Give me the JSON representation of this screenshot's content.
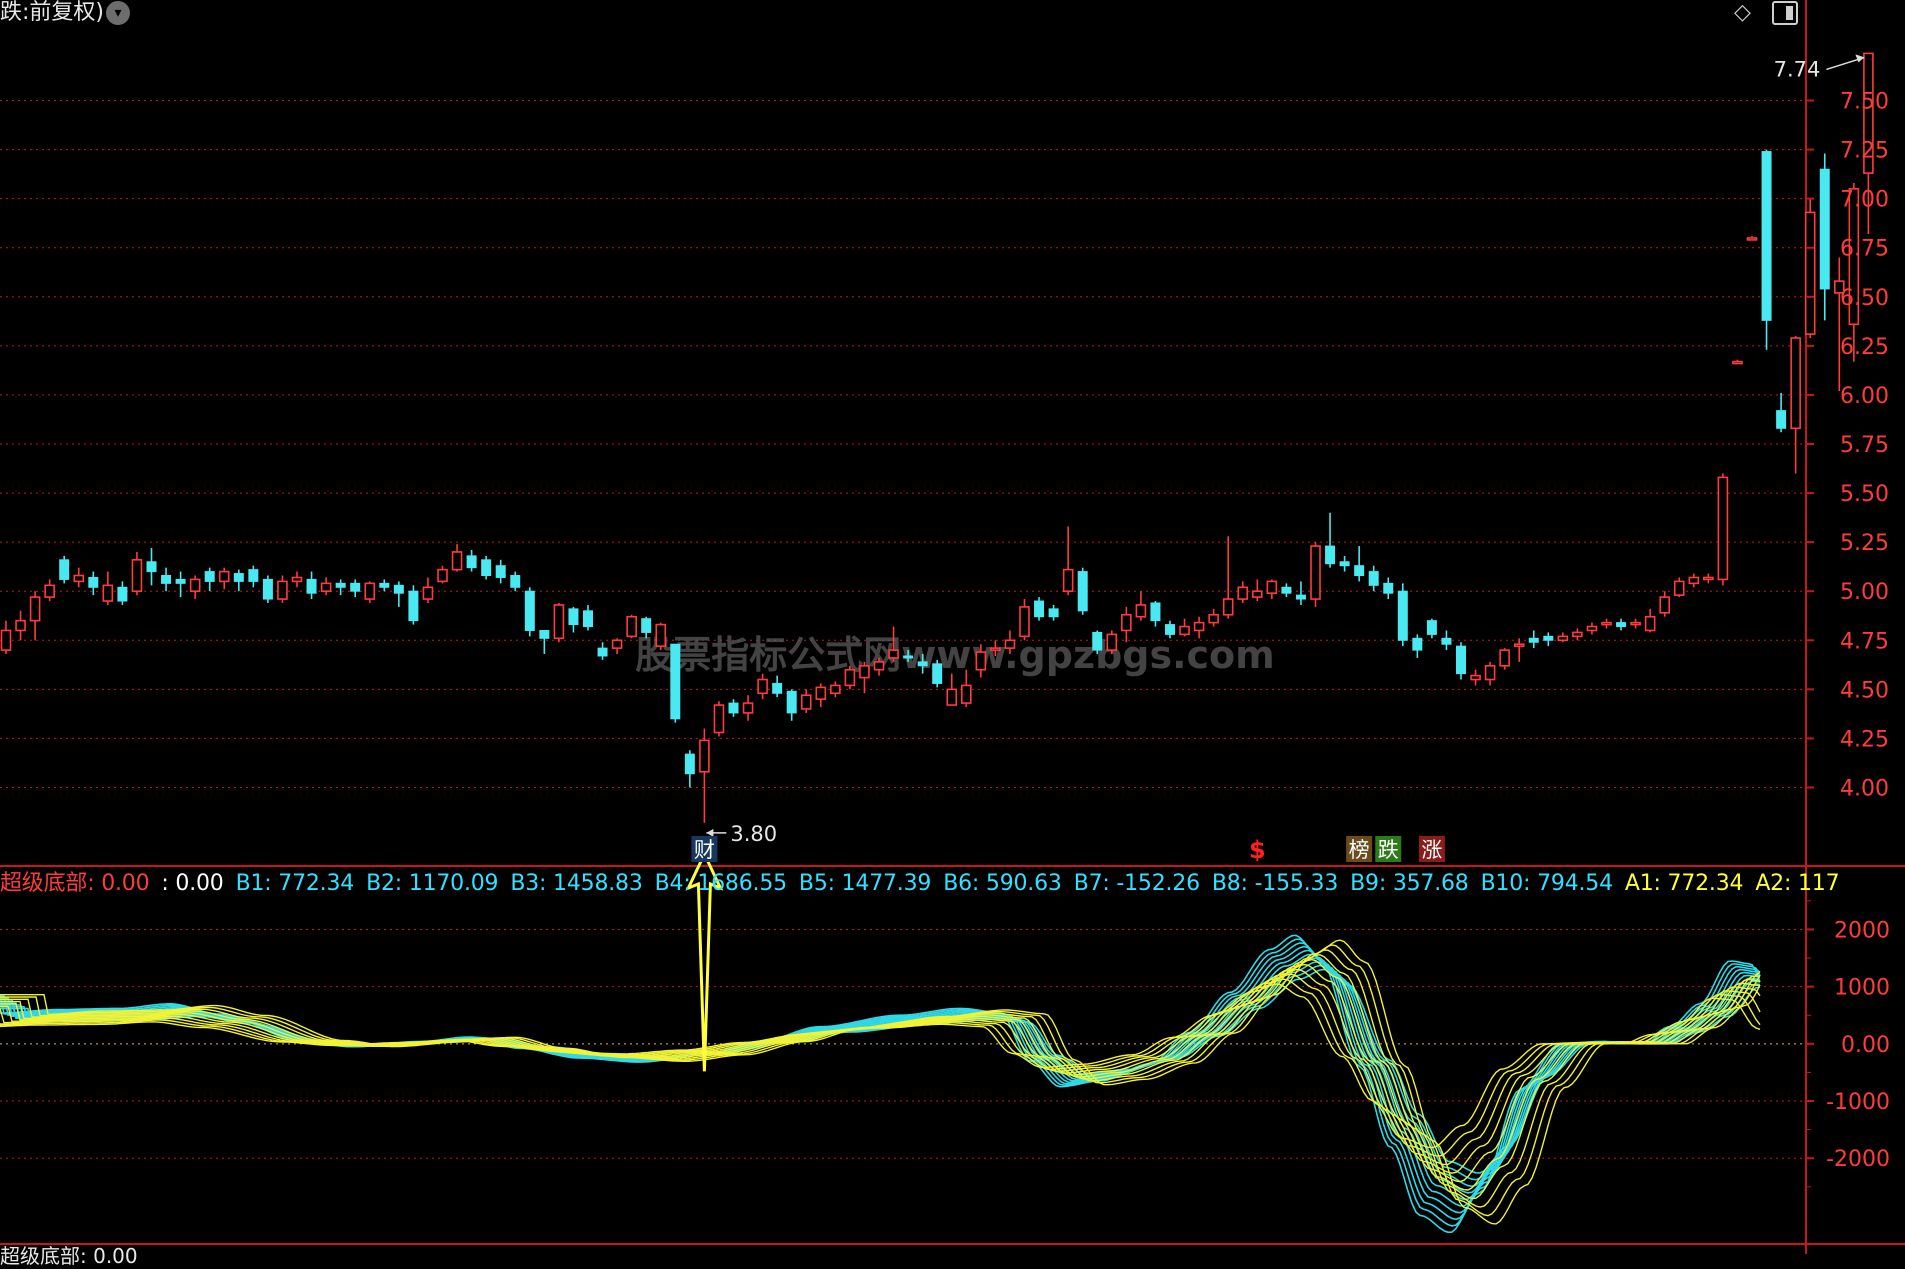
{
  "header": {
    "title": "跌:前复权)",
    "dropdown_icon": "chevron-down-icon",
    "tool_icons": [
      "diamond-icon",
      "panel-toggle-icon"
    ]
  },
  "watermark": "股票指标公式网www.gpzbgs.com",
  "price_axis": {
    "ticks": [
      "7.50",
      "7.25",
      "7.00",
      "6.75",
      "6.50",
      "6.25",
      "6.00",
      "5.75",
      "5.50",
      "5.25",
      "5.00",
      "4.75",
      "4.50",
      "4.25",
      "4.00"
    ],
    "ylim": [
      3.6,
      7.9
    ]
  },
  "annotations": {
    "high_label": "7.74",
    "low_label": "3.80",
    "event_cai": "财",
    "event_s": "$",
    "event_bang": "榜",
    "event_die": "跌",
    "event_zhang": "涨"
  },
  "indicator": {
    "name": "超级底部",
    "values": [
      {
        "label": "超级底部",
        "value": "0.00",
        "color": "#ff3b3b"
      },
      {
        "label": "",
        "value": "0.00",
        "color": "#ffffff"
      },
      {
        "label": "B1",
        "value": "772.34",
        "color": "#33e0ff"
      },
      {
        "label": "B2",
        "value": "1170.09",
        "color": "#33e0ff"
      },
      {
        "label": "B3",
        "value": "1458.83",
        "color": "#33e0ff"
      },
      {
        "label": "B4",
        "value": "1686.55",
        "color": "#33e0ff"
      },
      {
        "label": "B5",
        "value": "1477.39",
        "color": "#33e0ff"
      },
      {
        "label": "B6",
        "value": "590.63",
        "color": "#33e0ff"
      },
      {
        "label": "B7",
        "value": "-152.26",
        "color": "#33e0ff"
      },
      {
        "label": "B8",
        "value": "-155.33",
        "color": "#33e0ff"
      },
      {
        "label": "B9",
        "value": "357.68",
        "color": "#33e0ff"
      },
      {
        "label": "B10",
        "value": "794.54",
        "color": "#33e0ff"
      },
      {
        "label": "A1",
        "value": "772.34",
        "color": "#ffff33"
      },
      {
        "label": "A2",
        "value": "117",
        "color": "#ffff33"
      }
    ],
    "axis_ticks": [
      "2000",
      "1000",
      "0.00",
      "-1000",
      "-2000"
    ],
    "ylim": [
      -3500,
      2550
    ]
  },
  "bottom_label": "超级底部: 0.00",
  "colors": {
    "up": "#ff3b3b",
    "down": "#4ae8f0",
    "grid": "#c8161d",
    "axis_text": "#ff3b3b",
    "b_lines": "#2fd9e8",
    "a_lines": "#f2f236",
    "arrow": "#ffff3d"
  },
  "chart_data": {
    "type": "candlestick",
    "title": "",
    "ylabel": "",
    "candles": [
      [
        4.7,
        4.8,
        4.85,
        4.68
      ],
      [
        4.8,
        4.85,
        4.9,
        4.75
      ],
      [
        4.85,
        4.97,
        5.0,
        4.75
      ],
      [
        4.97,
        5.03,
        5.06,
        4.95
      ],
      [
        5.16,
        5.06,
        5.18,
        5.04
      ],
      [
        5.05,
        5.08,
        5.12,
        5.02
      ],
      [
        5.07,
        5.02,
        5.1,
        4.98
      ],
      [
        4.95,
        5.03,
        5.1,
        4.93
      ],
      [
        5.02,
        4.95,
        5.05,
        4.93
      ],
      [
        5.0,
        5.16,
        5.2,
        4.98
      ],
      [
        5.15,
        5.1,
        5.22,
        5.03
      ],
      [
        5.08,
        5.04,
        5.12,
        5.0
      ],
      [
        5.06,
        5.04,
        5.1,
        4.97
      ],
      [
        5.0,
        5.06,
        5.08,
        4.96
      ],
      [
        5.1,
        5.05,
        5.12,
        5.0
      ],
      [
        5.05,
        5.1,
        5.12,
        5.01
      ],
      [
        5.09,
        5.05,
        5.11,
        5.0
      ],
      [
        5.11,
        5.05,
        5.13,
        5.02
      ],
      [
        5.06,
        4.96,
        5.08,
        4.94
      ],
      [
        4.96,
        5.05,
        5.08,
        4.94
      ],
      [
        5.05,
        5.07,
        5.1,
        5.02
      ],
      [
        5.06,
        4.99,
        5.1,
        4.96
      ],
      [
        5.0,
        5.04,
        5.07,
        4.98
      ],
      [
        5.04,
        5.02,
        5.06,
        4.98
      ],
      [
        5.04,
        5.0,
        5.06,
        4.97
      ],
      [
        4.96,
        5.04,
        5.05,
        4.94
      ],
      [
        5.04,
        5.02,
        5.06,
        5.0
      ],
      [
        5.03,
        4.99,
        5.05,
        4.92
      ],
      [
        5.0,
        4.85,
        5.03,
        4.83
      ],
      [
        4.96,
        5.02,
        5.07,
        4.94
      ],
      [
        5.05,
        5.11,
        5.13,
        5.04
      ],
      [
        5.11,
        5.2,
        5.24,
        5.1
      ],
      [
        5.18,
        5.12,
        5.21,
        5.1
      ],
      [
        5.16,
        5.08,
        5.18,
        5.06
      ],
      [
        5.13,
        5.07,
        5.16,
        5.04
      ],
      [
        5.08,
        5.02,
        5.1,
        5.0
      ],
      [
        5.0,
        4.8,
        5.02,
        4.77
      ],
      [
        4.8,
        4.76,
        4.8,
        4.68
      ],
      [
        4.76,
        4.93,
        4.94,
        4.74
      ],
      [
        4.91,
        4.83,
        4.92,
        4.79
      ],
      [
        4.9,
        4.82,
        4.93,
        4.8
      ],
      [
        4.71,
        4.67,
        4.74,
        4.65
      ],
      [
        4.71,
        4.75,
        4.76,
        4.68
      ],
      [
        4.77,
        4.87,
        4.88,
        4.76
      ],
      [
        4.86,
        4.79,
        4.87,
        4.76
      ],
      [
        4.72,
        4.83,
        4.84,
        4.7
      ],
      [
        4.73,
        4.35,
        4.73,
        4.33
      ],
      [
        4.17,
        4.07,
        4.19,
        4.0
      ],
      [
        4.08,
        4.24,
        4.3,
        3.82
      ],
      [
        4.28,
        4.42,
        4.44,
        4.26
      ],
      [
        4.43,
        4.38,
        4.45,
        4.36
      ],
      [
        4.38,
        4.43,
        4.47,
        4.34
      ],
      [
        4.48,
        4.55,
        4.58,
        4.45
      ],
      [
        4.53,
        4.48,
        4.57,
        4.46
      ],
      [
        4.49,
        4.38,
        4.5,
        4.34
      ],
      [
        4.4,
        4.47,
        4.5,
        4.38
      ],
      [
        4.45,
        4.51,
        4.53,
        4.41
      ],
      [
        4.48,
        4.52,
        4.54,
        4.46
      ],
      [
        4.52,
        4.6,
        4.62,
        4.5
      ],
      [
        4.56,
        4.62,
        4.64,
        4.48
      ],
      [
        4.6,
        4.64,
        4.66,
        4.57
      ],
      [
        4.66,
        4.7,
        4.82,
        4.64
      ],
      [
        4.67,
        4.66,
        4.7,
        4.64
      ],
      [
        4.64,
        4.62,
        4.68,
        4.58
      ],
      [
        4.63,
        4.53,
        4.65,
        4.51
      ],
      [
        4.42,
        4.5,
        4.58,
        4.42
      ],
      [
        4.43,
        4.52,
        4.6,
        4.41
      ],
      [
        4.6,
        4.69,
        4.73,
        4.56
      ],
      [
        4.7,
        4.71,
        4.75,
        4.67
      ],
      [
        4.71,
        4.75,
        4.8,
        4.68
      ],
      [
        4.77,
        4.92,
        4.96,
        4.75
      ],
      [
        4.95,
        4.87,
        4.97,
        4.85
      ],
      [
        4.91,
        4.87,
        4.93,
        4.85
      ],
      [
        5.0,
        5.11,
        5.33,
        4.98
      ],
      [
        5.1,
        4.9,
        5.12,
        4.88
      ],
      [
        4.79,
        4.7,
        4.8,
        4.68
      ],
      [
        4.7,
        4.78,
        4.8,
        4.68
      ],
      [
        4.8,
        4.88,
        4.92,
        4.74
      ],
      [
        4.87,
        4.93,
        5.0,
        4.85
      ],
      [
        4.94,
        4.85,
        4.95,
        4.82
      ],
      [
        4.83,
        4.78,
        4.85,
        4.76
      ],
      [
        4.78,
        4.82,
        4.86,
        4.77
      ],
      [
        4.8,
        4.84,
        4.87,
        4.76
      ],
      [
        4.84,
        4.88,
        4.91,
        4.82
      ],
      [
        4.88,
        4.96,
        5.28,
        4.86
      ],
      [
        4.96,
        5.02,
        5.05,
        4.94
      ],
      [
        4.97,
        5.0,
        5.06,
        4.95
      ],
      [
        4.99,
        5.05,
        5.06,
        4.96
      ],
      [
        5.02,
        4.99,
        5.04,
        4.97
      ],
      [
        4.98,
        4.96,
        5.05,
        4.93
      ],
      [
        4.96,
        5.23,
        5.25,
        4.92
      ],
      [
        5.23,
        5.14,
        5.4,
        5.12
      ],
      [
        5.15,
        5.13,
        5.18,
        5.1
      ],
      [
        5.13,
        5.08,
        5.23,
        5.05
      ],
      [
        5.1,
        5.03,
        5.13,
        5.0
      ],
      [
        5.04,
        4.99,
        5.07,
        4.96
      ],
      [
        5.0,
        4.75,
        5.04,
        4.72
      ],
      [
        4.76,
        4.7,
        4.78,
        4.66
      ],
      [
        4.85,
        4.78,
        4.86,
        4.76
      ],
      [
        4.76,
        4.73,
        4.8,
        4.7
      ],
      [
        4.72,
        4.58,
        4.74,
        4.55
      ],
      [
        4.55,
        4.57,
        4.6,
        4.52
      ],
      [
        4.55,
        4.62,
        4.64,
        4.52
      ],
      [
        4.62,
        4.7,
        4.71,
        4.6
      ],
      [
        4.72,
        4.73,
        4.76,
        4.64
      ],
      [
        4.76,
        4.74,
        4.8,
        4.71
      ],
      [
        4.77,
        4.75,
        4.79,
        4.72
      ],
      [
        4.75,
        4.77,
        4.79,
        4.74
      ],
      [
        4.77,
        4.79,
        4.81,
        4.75
      ],
      [
        4.8,
        4.82,
        4.84,
        4.78
      ],
      [
        4.83,
        4.84,
        4.86,
        4.81
      ],
      [
        4.84,
        4.82,
        4.86,
        4.8
      ],
      [
        4.83,
        4.84,
        4.86,
        4.81
      ],
      [
        4.8,
        4.87,
        4.91,
        4.79
      ],
      [
        4.89,
        4.97,
        5.0,
        4.87
      ],
      [
        4.98,
        5.05,
        5.07,
        4.97
      ],
      [
        5.04,
        5.07,
        5.09,
        5.02
      ],
      [
        5.06,
        5.07,
        5.09,
        5.04
      ],
      [
        5.06,
        5.58,
        5.6,
        5.03
      ],
      [
        6.17,
        6.17,
        6.18,
        6.16
      ],
      [
        6.8,
        6.8,
        6.81,
        6.79
      ],
      [
        7.24,
        6.38,
        7.25,
        6.23
      ],
      [
        5.92,
        5.83,
        6.01,
        5.81
      ],
      [
        5.83,
        6.29,
        6.3,
        5.6
      ],
      [
        6.31,
        6.93,
        7.0,
        6.29
      ],
      [
        7.15,
        6.54,
        7.23,
        6.38
      ],
      [
        6.52,
        6.58,
        6.7,
        6.02
      ],
      [
        6.36,
        7.05,
        7.08,
        6.17
      ],
      [
        7.13,
        7.74,
        7.74,
        6.82
      ]
    ],
    "indicator_series": {
      "legend": [
        "B1",
        "B2",
        "B3",
        "B4",
        "B5",
        "B6",
        "B7",
        "B8",
        "B9",
        "B10",
        "A1",
        "A2"
      ]
    }
  }
}
